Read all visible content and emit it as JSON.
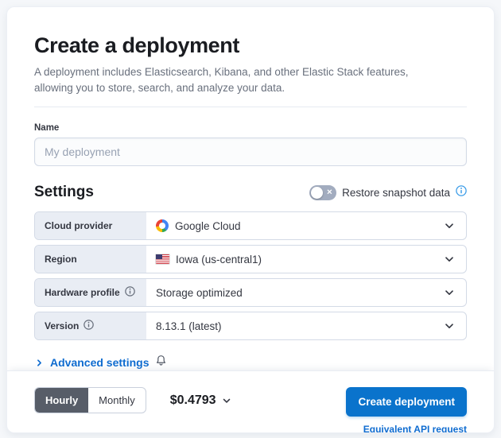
{
  "header": {
    "title": "Create a deployment",
    "subtitle": "A deployment includes Elasticsearch, Kibana, and other Elastic Stack features, allowing you to store, search, and analyze your data."
  },
  "name_field": {
    "label": "Name",
    "placeholder": "My deployment",
    "value": ""
  },
  "settings": {
    "heading": "Settings",
    "restore_snapshot": {
      "label": "Restore snapshot data",
      "state": "off"
    },
    "rows": [
      {
        "label": "Cloud provider",
        "value": "Google Cloud",
        "icon": "google-cloud-icon",
        "has_info": false
      },
      {
        "label": "Region",
        "value": "Iowa (us-central1)",
        "icon": "us-flag-icon",
        "has_info": false
      },
      {
        "label": "Hardware profile",
        "value": "Storage optimized",
        "icon": null,
        "has_info": true
      },
      {
        "label": "Version",
        "value": "8.13.1 (latest)",
        "icon": null,
        "has_info": true
      }
    ]
  },
  "advanced_settings": {
    "label": "Advanced settings"
  },
  "footer": {
    "billing_toggle": {
      "options": [
        "Hourly",
        "Monthly"
      ],
      "selected": "Hourly"
    },
    "price": "$0.4793",
    "create_button": "Create deployment",
    "api_link": "Equivalent API request"
  },
  "colors": {
    "primary_button": "#0a73cc",
    "link_blue": "#0f6cd0",
    "info_blue": "#3d9de8",
    "row_label_bg": "#e9edf4",
    "selected_segment_bg": "#575d68",
    "page_bg": "#f5f7fa"
  }
}
